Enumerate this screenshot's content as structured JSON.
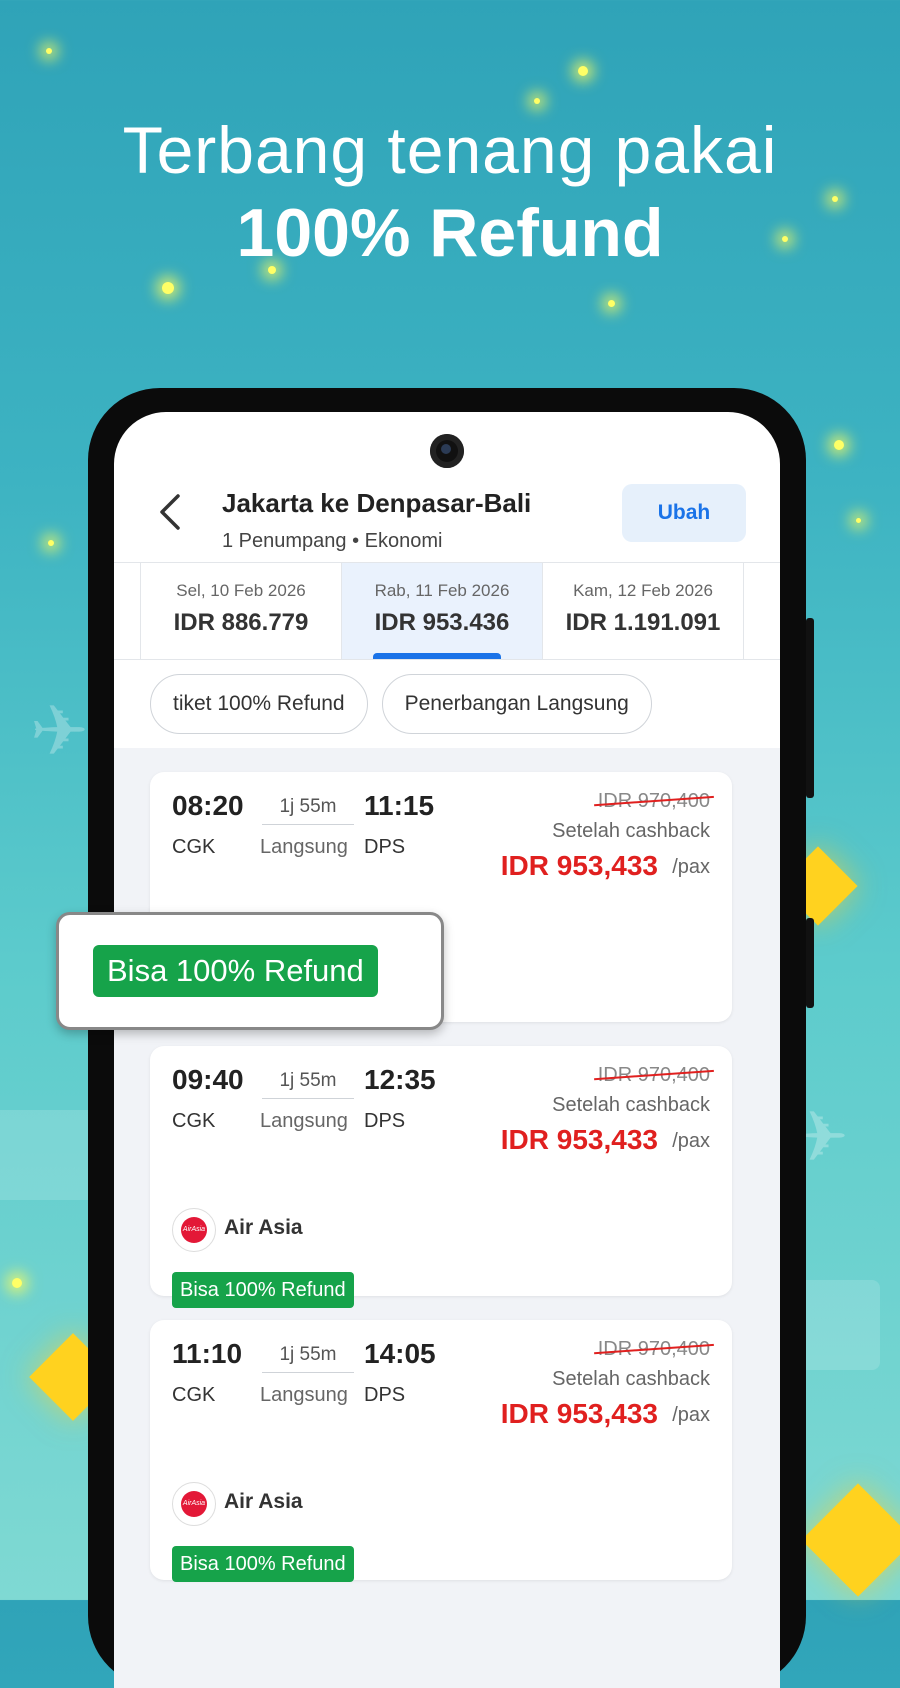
{
  "hero": {
    "line1": "Terbang tenang pakai",
    "line2": "100% Refund"
  },
  "header": {
    "back_icon": "chevron-left-icon",
    "title": "Jakarta ke Denpasar-Bali",
    "subtitle": "1 Penumpang • Ekonomi",
    "change_label": "Ubah"
  },
  "dates": [
    {
      "date": "Sel, 10 Feb 2026",
      "price": "IDR 886.779",
      "active": false
    },
    {
      "date": "Rab, 11 Feb 2026",
      "price": "IDR 953.436",
      "active": true
    },
    {
      "date": "Kam, 12 Feb 2026",
      "price": "IDR 1.191.091",
      "active": false
    }
  ],
  "filters": [
    "tiket 100% Refund",
    "Penerbangan Langsung"
  ],
  "flights": [
    {
      "dep_time": "08:20",
      "dep_code": "CGK",
      "duration": "1j 55m",
      "type": "Langsung",
      "arr_time": "11:15",
      "arr_code": "DPS",
      "original_price": "IDR 970,400",
      "cashback_label": "Setelah cashback",
      "price": "IDR 953,433",
      "per": "/pax",
      "airline": "",
      "refund": ""
    },
    {
      "dep_time": "09:40",
      "dep_code": "CGK",
      "duration": "1j 55m",
      "type": "Langsung",
      "arr_time": "12:35",
      "arr_code": "DPS",
      "original_price": "IDR 970,400",
      "cashback_label": "Setelah cashback",
      "price": "IDR 953,433",
      "per": "/pax",
      "airline": "Air Asia",
      "refund": "Bisa 100% Refund"
    },
    {
      "dep_time": "11:10",
      "dep_code": "CGK",
      "duration": "1j 55m",
      "type": "Langsung",
      "arr_time": "14:05",
      "arr_code": "DPS",
      "original_price": "IDR 970,400",
      "cashback_label": "Setelah cashback",
      "price": "IDR 953,433",
      "per": "/pax",
      "airline": "Air Asia",
      "refund": "Bisa 100% Refund"
    }
  ],
  "callout": {
    "label": "Bisa 100% Refund"
  },
  "airline_logo_text": "AirAsia",
  "colors": {
    "accent": "#1a73e8",
    "price_red": "#e0201f",
    "refund_green": "#16a34a"
  }
}
